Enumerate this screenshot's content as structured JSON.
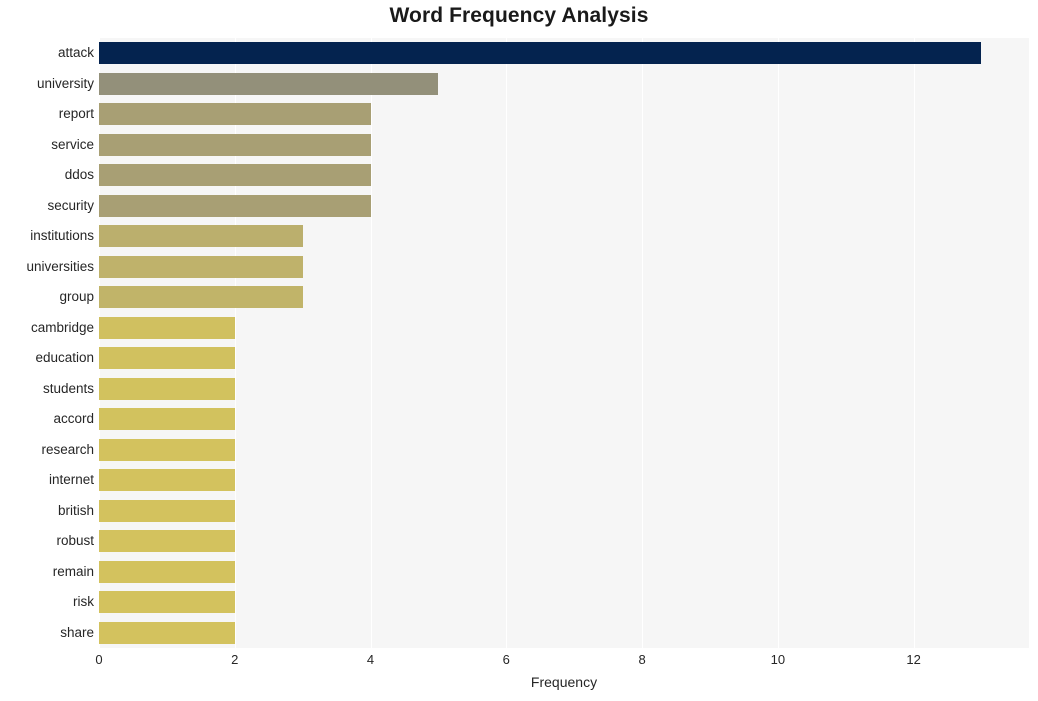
{
  "chart_data": {
    "type": "bar",
    "orientation": "horizontal",
    "title": "Word Frequency Analysis",
    "xlabel": "Frequency",
    "ylabel": "",
    "xlim": [
      0,
      13.7
    ],
    "ylim": [
      0,
      20
    ],
    "grid": "vertical-white-gridlines",
    "legend": "none",
    "xticks": [
      0,
      2,
      4,
      6,
      8,
      10,
      12
    ],
    "xtick_labels": [
      "0",
      "2",
      "4",
      "6",
      "8",
      "10",
      "12"
    ],
    "categories": [
      "attack",
      "university",
      "report",
      "service",
      "ddos",
      "security",
      "institutions",
      "universities",
      "group",
      "cambridge",
      "education",
      "students",
      "accord",
      "research",
      "internet",
      "british",
      "robust",
      "remain",
      "risk",
      "share"
    ],
    "values": [
      13,
      5,
      4,
      4,
      4,
      4,
      3,
      3,
      3,
      2,
      2,
      2,
      2,
      2,
      2,
      2,
      2,
      2,
      2,
      2
    ],
    "bar_colors": [
      "#04234f",
      "#93907a",
      "#a89f74",
      "#a89f74",
      "#a89f74",
      "#a89f74",
      "#bbaf6d",
      "#bfb26b",
      "#c1b469",
      "#d0c060",
      "#d1c15f",
      "#d2c25e",
      "#d2c25e",
      "#d3c25e",
      "#d3c25e",
      "#d3c25e",
      "#d3c25e",
      "#d3c25e",
      "#d3c25e",
      "#d3c25e"
    ]
  },
  "style": {
    "plot_background": "#f6f6f6",
    "figure_background": "#ffffff",
    "gridline_color": "#ffffff",
    "text_color": "#262626",
    "accent_color": "#04234f",
    "highlight_color": "#d3c25e"
  }
}
